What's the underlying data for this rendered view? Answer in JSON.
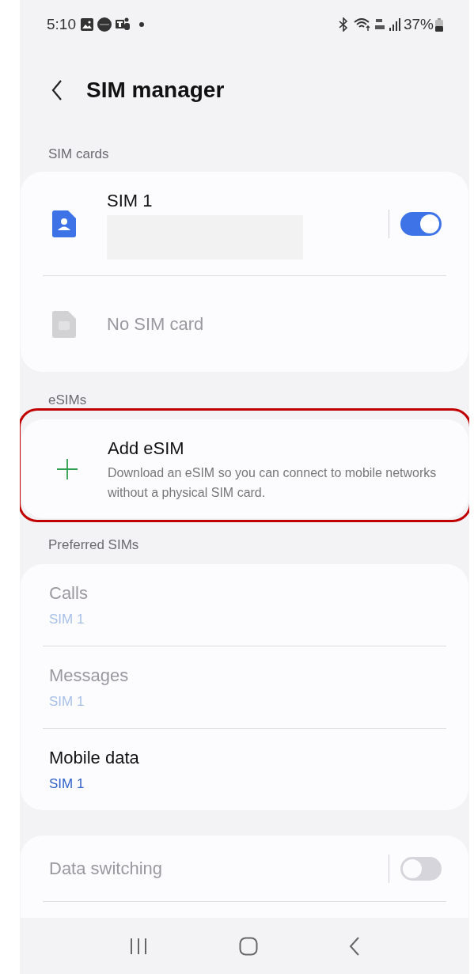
{
  "status_bar": {
    "time": "5:10",
    "battery": "37%"
  },
  "header": {
    "title": "SIM manager"
  },
  "sections": [
    {
      "label": "SIM cards",
      "items": [
        {
          "kind": "sim",
          "title": "SIM 1",
          "redacted": true,
          "disabled": false,
          "on": true
        },
        {
          "kind": "sim",
          "title": "No SIM card",
          "redacted": false,
          "disabled": true
        }
      ]
    },
    {
      "label": "eSIMs",
      "highlighted": true,
      "items": [
        {
          "kind": "add",
          "title": "Add eSIM",
          "subtitle": "Download an eSIM so you can connect to mobile networks without a physical SIM card.",
          "disabled": false
        }
      ]
    },
    {
      "label": "Preferred SIMs",
      "items": [
        {
          "kind": "setting",
          "title": "Calls",
          "value": "SIM 1",
          "disabled": true
        },
        {
          "kind": "setting",
          "title": "Messages",
          "value": "SIM 1",
          "disabled": true
        },
        {
          "kind": "setting",
          "title": "Mobile data",
          "value": "SIM 1",
          "disabled": false
        }
      ]
    },
    {
      "items": [
        {
          "kind": "switch",
          "title": "Data switching",
          "disabled": true,
          "on": false
        },
        {
          "kind": "hidden"
        }
      ]
    }
  ]
}
